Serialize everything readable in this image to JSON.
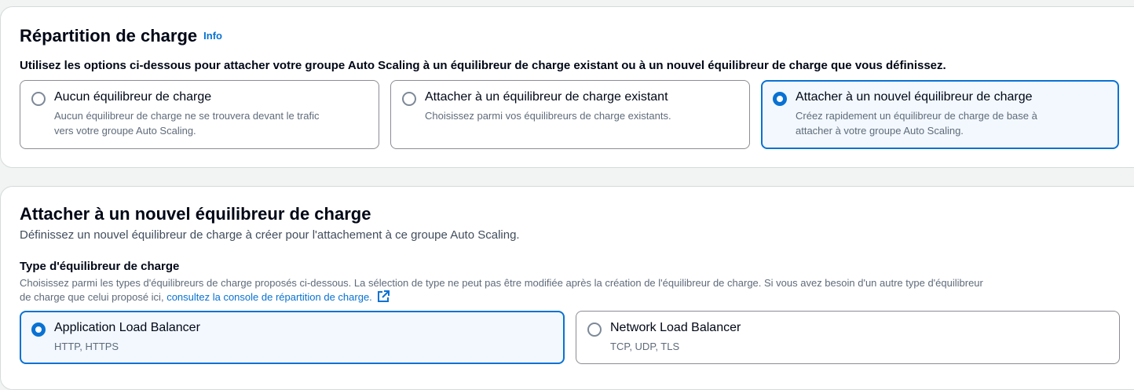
{
  "section1": {
    "title": "Répartition de charge",
    "info": "Info",
    "description": "Utilisez les options ci-dessous pour attacher votre groupe Auto Scaling à un équilibreur de charge existant ou à un nouvel équilibreur de charge que vous définissez.",
    "options": [
      {
        "title": "Aucun équilibreur de charge",
        "line1": "Aucun équilibreur de charge ne se trouvera devant le trafic",
        "line2": "vers votre groupe Auto Scaling.",
        "selected": false
      },
      {
        "title": "Attacher à un équilibreur de charge existant",
        "line1": "Choisissez parmi vos équilibreurs de charge existants.",
        "line2": "",
        "selected": false
      },
      {
        "title": "Attacher à un nouvel équilibreur de charge",
        "line1": "Créez rapidement un équilibreur de charge de base à",
        "line2": "attacher à votre groupe Auto Scaling.",
        "selected": true
      }
    ]
  },
  "section2": {
    "title": "Attacher à un nouvel équilibreur de charge",
    "description": "Définissez un nouvel équilibreur de charge à créer pour l'attachement à ce groupe Auto Scaling.",
    "type_label": "Type d'équilibreur de charge",
    "type_help_line1": "Choisissez parmi les types d'équilibreurs de charge proposés ci-dessous. La sélection de type ne peut pas être modifiée après la création de l'équilibreur de charge. Si vous avez besoin d'un autre type d'équilibreur",
    "type_help_line2": "de charge que celui proposé ici, ",
    "console_link": "consultez la console de répartition de charge.",
    "options": [
      {
        "title": "Application Load Balancer",
        "sub": "HTTP, HTTPS",
        "selected": true
      },
      {
        "title": "Network Load Balancer",
        "sub": "TCP, UDP, TLS",
        "selected": false
      }
    ]
  },
  "colors": {
    "accent": "#0972d3",
    "selected_bg": "#f2f8fd",
    "border": "#8c8c94"
  },
  "icons": {
    "external_link": "external-link-icon"
  }
}
